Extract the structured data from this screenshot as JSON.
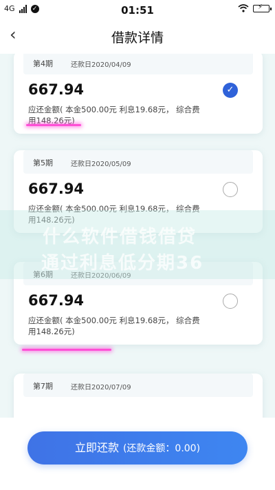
{
  "status_bar": {
    "network": "4G",
    "time": "01:51"
  },
  "nav": {
    "back_icon": "chevron-left",
    "title": "借款详情"
  },
  "installments": [
    {
      "period": "第4期",
      "due_date": "还款日2020/04/09",
      "amount": "667.94",
      "detail": "应还金额( 本金500.00元 利息19.68元，  综合费用148.26元)",
      "selected": true
    },
    {
      "period": "第5期",
      "due_date": "还款日2020/05/09",
      "amount": "667.94",
      "detail": "应还金额( 本金500.00元 利息19.68元，  综合费用148.26元)",
      "selected": false
    },
    {
      "period": "第6期",
      "due_date": "还款日2020/06/09",
      "amount": "667.94",
      "detail": "应还金额( 本金500.00元 利息19.68元，  综合费用148.26元)",
      "selected": false
    },
    {
      "period": "第7期",
      "due_date": "还款日2020/07/09"
    }
  ],
  "watermark": {
    "line1": "什么软件借钱借贷",
    "line2": "通过利息低分期36"
  },
  "bottom": {
    "pay_label": "立即还款",
    "pay_sub": "(还款金额：0.00)"
  },
  "colors": {
    "accent": "#2f62d9",
    "button": "#3e7deb",
    "highlight": "#ff4fd6",
    "background": "#eef7f7"
  }
}
